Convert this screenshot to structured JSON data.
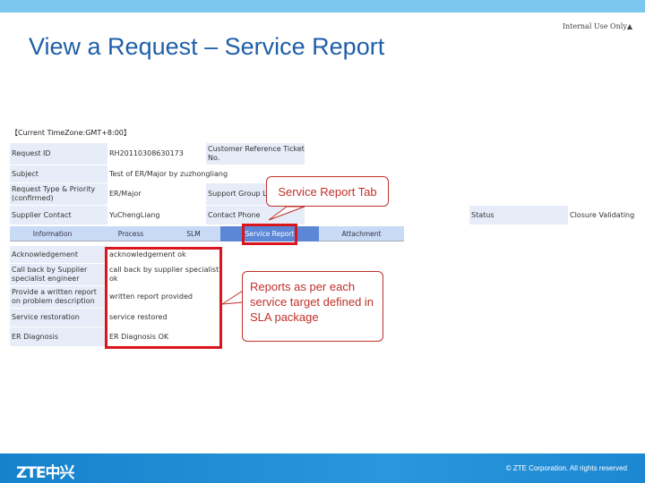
{
  "header": {
    "internal": "Internal Use Only▲",
    "title": "View a Request – Service Report"
  },
  "form": {
    "timezone": "【Current TimeZone:GMT+8:00】",
    "request_id_label": "Request ID",
    "request_id": "RH20110308630173",
    "cust_ref_label": "Customer Reference Ticket No.",
    "subject_label": "Subject",
    "subject": "Test of ER/Major by zuzhongliang",
    "type_label": "Request Type & Priority (confirmed)",
    "type": "ER/Major",
    "support_label": "Support Group L",
    "supplier_label": "Supplier Contact",
    "supplier": "YuChengLiang",
    "phone_label": "Contact Phone",
    "status_label": "Status",
    "status": "Closure Validating"
  },
  "tabs": [
    {
      "label": "Information"
    },
    {
      "label": "Process"
    },
    {
      "label": "SLM"
    },
    {
      "label": "Service Report",
      "active": true
    },
    {
      "label": "Attachment"
    }
  ],
  "report": [
    {
      "label": "Acknowledgement",
      "value": "acknowledgement ok"
    },
    {
      "label": "Call back by Supplier specialist engineer",
      "value": "call back by supplier specialist ok"
    },
    {
      "label": "Provide a written report on problem description",
      "value": "written report provided"
    },
    {
      "label": "Service restoration",
      "value": "service restored"
    },
    {
      "label": "ER Diagnosis",
      "value": "ER Diagnosis OK"
    }
  ],
  "callouts": {
    "tab": "Service Report Tab",
    "reports": "Reports as per each service target defined in SLA package"
  },
  "footer": {
    "logo": "ZTE中兴",
    "copyright": "© ZTE Corporation. All rights reserved"
  },
  "colors": {
    "accent": "#1f5fa8",
    "highlight": "#d8161c",
    "footer": "#1a8ad4"
  }
}
